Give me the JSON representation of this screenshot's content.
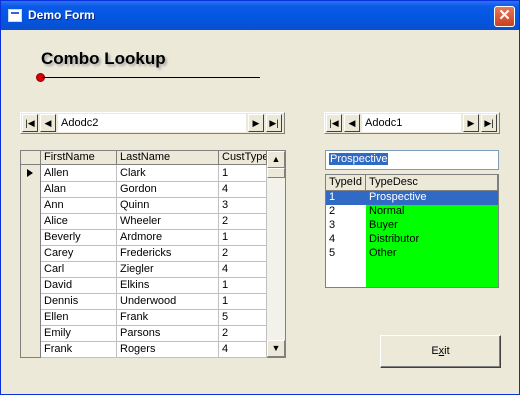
{
  "window": {
    "title": "Demo Form",
    "close_glyph": "✕"
  },
  "heading": "Combo Lookup",
  "adodc_left": {
    "caption": "Adodc2"
  },
  "adodc_right": {
    "caption": "Adodc1"
  },
  "nav_glyphs": {
    "first": "|◀",
    "prev": "◀",
    "next": "▶",
    "last": "▶|"
  },
  "grid": {
    "columns": [
      "FirstName",
      "LastName",
      "CustType"
    ],
    "rows": [
      [
        "Allen",
        "Clark",
        "1"
      ],
      [
        "Alan",
        "Gordon",
        "4"
      ],
      [
        "Ann",
        "Quinn",
        "3"
      ],
      [
        "Alice",
        "Wheeler",
        "2"
      ],
      [
        "Beverly",
        "Ardmore",
        "1"
      ],
      [
        "Carey",
        "Fredericks",
        "2"
      ],
      [
        "Carl",
        "Ziegler",
        "4"
      ],
      [
        "David",
        "Elkins",
        "1"
      ],
      [
        "Dennis",
        "Underwood",
        "1"
      ],
      [
        "Ellen",
        "Frank",
        "5"
      ],
      [
        "Emily",
        "Parsons",
        "2"
      ],
      [
        "Frank",
        "Rogers",
        "4"
      ]
    ],
    "current_row": 0,
    "scroll": {
      "up": "▲",
      "down": "▼"
    }
  },
  "combo": {
    "text": "Prospective",
    "columns": [
      "TypeId",
      "TypeDesc"
    ],
    "rows": [
      [
        "1",
        "Prospective"
      ],
      [
        "2",
        "Normal"
      ],
      [
        "3",
        "Buyer"
      ],
      [
        "4",
        "Distributor"
      ],
      [
        "5",
        "Other"
      ]
    ],
    "selected_row": 0
  },
  "exit_button": {
    "label": "Exit",
    "hotkey_char": "x"
  },
  "colors": {
    "highlight": "#316ac5",
    "list_desc_bg": "#00ff00",
    "title_bar": "#0256e0"
  }
}
